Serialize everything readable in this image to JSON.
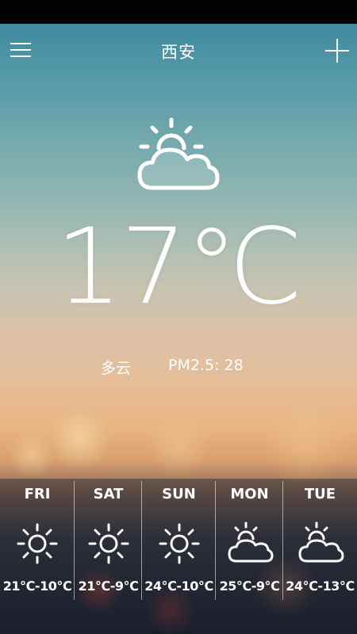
{
  "header": {
    "city": "西安",
    "menu_icon": "hamburger-menu-icon",
    "add_icon": "plus-icon"
  },
  "current": {
    "icon": "partly-cloudy-icon",
    "temperature": "17℃",
    "condition": "多云",
    "pm25": "PM2.5: 28"
  },
  "forecast": [
    {
      "day": "FRI",
      "icon": "sunny-icon",
      "range": "21℃-10℃"
    },
    {
      "day": "SAT",
      "icon": "sunny-icon",
      "range": "21℃-9℃"
    },
    {
      "day": "SUN",
      "icon": "sunny-icon",
      "range": "24℃-10℃"
    },
    {
      "day": "MON",
      "icon": "partly-cloudy-icon",
      "range": "25℃-9℃"
    },
    {
      "day": "TUE",
      "icon": "partly-cloudy-icon",
      "range": "24℃-13℃"
    }
  ],
  "colors": {
    "text": "#ffffff",
    "sky_top": "#3f8aa1",
    "sky_horizon": "#e8b582",
    "city_night": "#1d2030"
  }
}
